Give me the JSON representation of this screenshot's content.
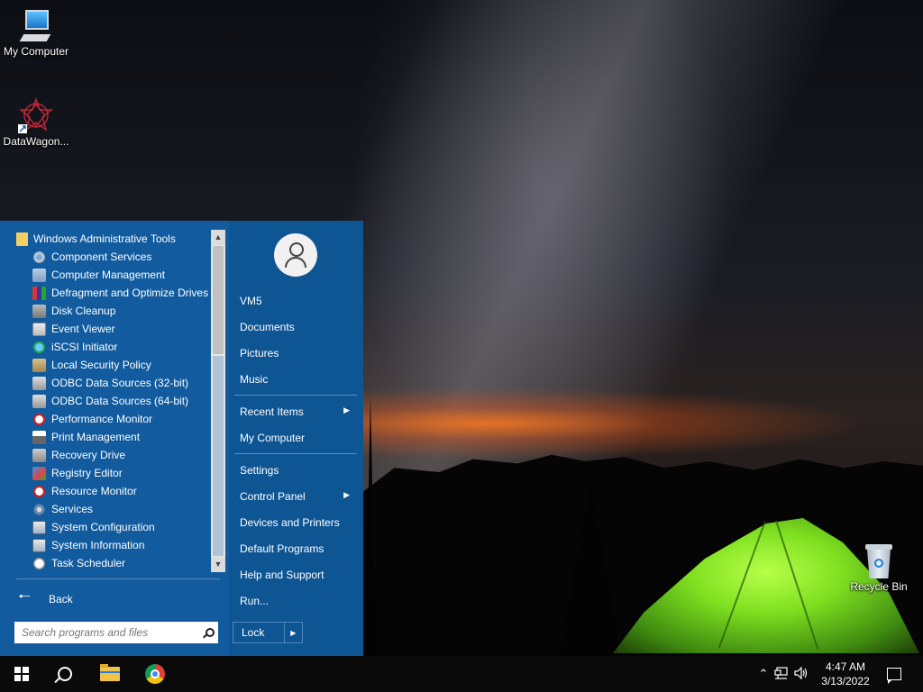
{
  "desktop": {
    "icons": [
      {
        "label": "My Computer"
      },
      {
        "label": "DataWagon..."
      },
      {
        "label": "Recycle Bin"
      }
    ]
  },
  "start_menu": {
    "folder": "Windows Administrative Tools",
    "programs": [
      "Component Services",
      "Computer Management",
      "Defragment and Optimize Drives",
      "Disk Cleanup",
      "Event Viewer",
      "iSCSI Initiator",
      "Local Security Policy",
      "ODBC Data Sources (32-bit)",
      "ODBC Data Sources (64-bit)",
      "Performance Monitor",
      "Print Management",
      "Recovery Drive",
      "Registry Editor",
      "Resource Monitor",
      "Services",
      "System Configuration",
      "System Information",
      "Task Scheduler"
    ],
    "back_label": "Back",
    "search_placeholder": "Search programs and files",
    "right": {
      "user": "VM5",
      "documents": "Documents",
      "pictures": "Pictures",
      "music": "Music",
      "recent_items": "Recent Items",
      "my_computer": "My Computer",
      "settings": "Settings",
      "control_panel": "Control Panel",
      "devices_printers": "Devices and Printers",
      "default_programs": "Default Programs",
      "help_support": "Help and Support",
      "run": "Run...",
      "lock": "Lock"
    }
  },
  "taskbar": {
    "time": "4:47 AM",
    "date": "3/13/2022"
  },
  "colors": {
    "start_menu_bg": "#0f5a9c",
    "taskbar_bg": "#0a0a0a"
  }
}
